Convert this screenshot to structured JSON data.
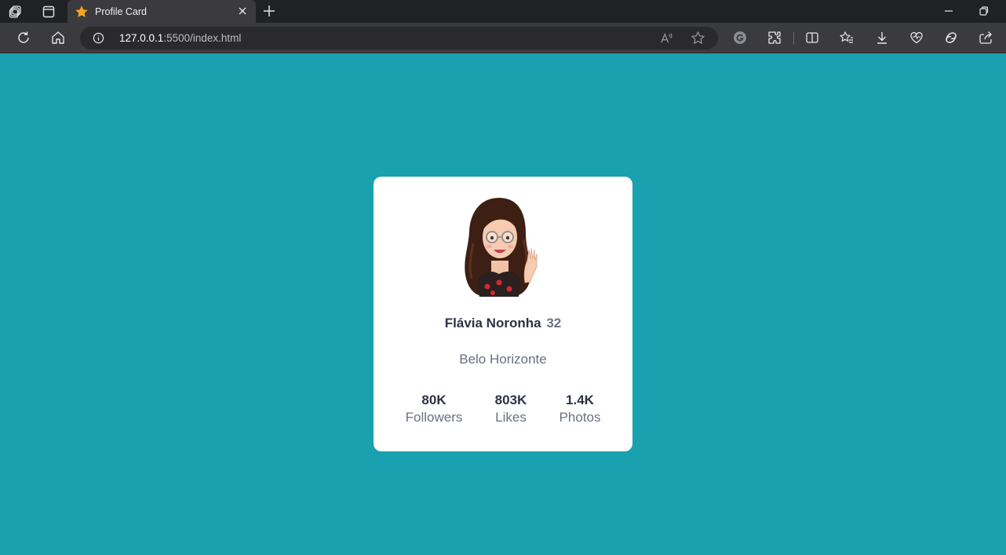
{
  "browser": {
    "tab_title": "Profile Card",
    "url_host": "127.0.0.1",
    "url_rest": ":5500/index.html"
  },
  "profile": {
    "name": "Flávia Noronha",
    "age": "32",
    "city": "Belo Horizonte",
    "stats": [
      {
        "value": "80K",
        "label": "Followers"
      },
      {
        "value": "803K",
        "label": "Likes"
      },
      {
        "value": "1.4K",
        "label": "Photos"
      }
    ]
  },
  "colors": {
    "page_background": "#19a1af",
    "card_background": "#ffffff",
    "text_dark": "#2e3246",
    "text_muted": "#6b7082",
    "tab_star": "#f5a623"
  }
}
